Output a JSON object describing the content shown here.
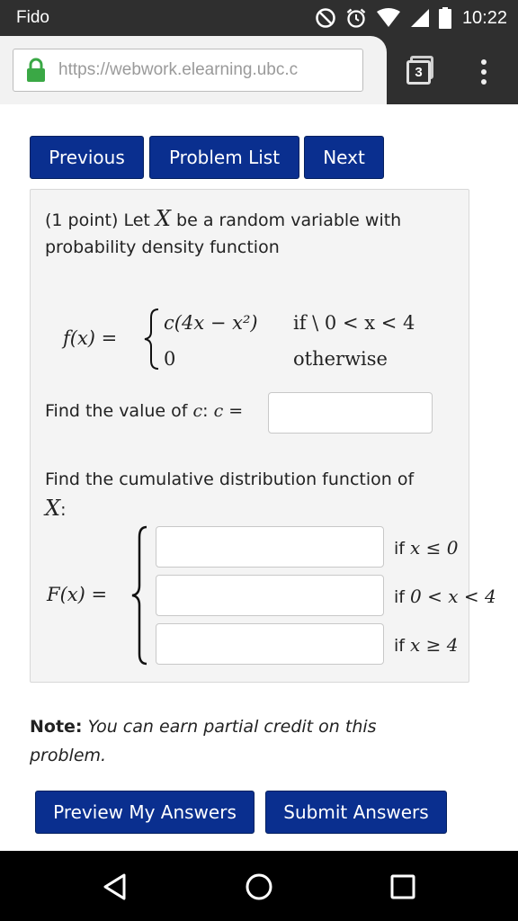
{
  "status_bar": {
    "carrier": "Fido",
    "time": "10:22",
    "icons": [
      "do-not-disturb-icon",
      "alarm-icon",
      "wifi-icon",
      "signal-icon",
      "battery-icon"
    ]
  },
  "browser": {
    "url": "https://webwork.elearning.ubc.c",
    "tab_count": "3",
    "lock_color": "#3aa845"
  },
  "nav": {
    "previous": "Previous",
    "problem_list": "Problem List",
    "next": "Next"
  },
  "problem": {
    "intro_1a": "(1 point) Let ",
    "var_X": "X",
    "intro_1b": " be a random variable with",
    "intro_2": "probability density function",
    "pdf_lhs": "f(x) =",
    "pdf_case1_expr": "c(4x − x²)",
    "pdf_case1_cond": "if \\ 0 < x < 4",
    "pdf_case2_expr": "0",
    "pdf_case2_cond": "otherwise",
    "find_c_text": "Find the value of ",
    "find_c_var": "c",
    "find_c_colon": ": ",
    "find_c_eq": "c =",
    "c_value": "",
    "cdf_text_1": "Find the cumulative distribution function of",
    "cdf_var": "X",
    "cdf_colon": ":",
    "cdf_lhs": "F(x) =",
    "cdf_rows": [
      {
        "if": "if ",
        "cond": "x ≤ 0",
        "value": ""
      },
      {
        "if": "if ",
        "cond": "0 < x < 4",
        "value": ""
      },
      {
        "if": "if ",
        "cond": "x ≥ 4",
        "value": ""
      }
    ]
  },
  "note": {
    "label": "Note:",
    "text_1": " You can earn partial credit on this",
    "text_2": "problem."
  },
  "actions": {
    "preview": "Preview My Answers",
    "submit": "Submit Answers"
  },
  "colors": {
    "button_bg": "#0a2f8f",
    "problem_bg": "#f4f4f4",
    "chrome_bg": "#2f2f2f"
  }
}
